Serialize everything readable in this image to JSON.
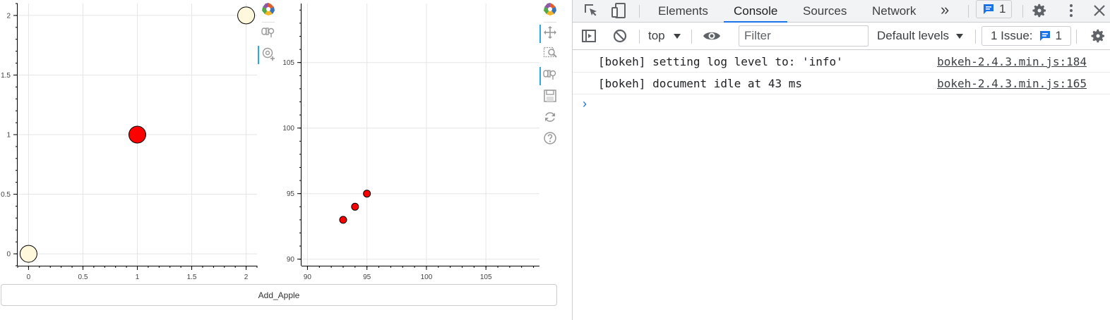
{
  "bokeh": {
    "button_label": "Add_Apple",
    "toolbar_left": [
      "bokeh-logo-icon",
      "wheel-zoom-icon",
      "hover-icon"
    ],
    "toolbar_right": [
      "bokeh-logo-icon",
      "pan-icon",
      "box-zoom-icon",
      "wheel-zoom-icon",
      "save-icon",
      "reset-icon",
      "help-icon"
    ]
  },
  "chart_data": [
    {
      "type": "scatter",
      "xlim": [
        -0.1,
        2.1
      ],
      "ylim": [
        -0.1,
        2.1
      ],
      "xticks": [
        "0",
        "0.5",
        "1",
        "1.5",
        "2"
      ],
      "yticks": [
        "0",
        "0.5",
        "1",
        "1.5",
        "2"
      ],
      "grid": true,
      "points": [
        {
          "x": 0,
          "y": 0,
          "size": 24,
          "color": "#fff8dc"
        },
        {
          "x": 1,
          "y": 1,
          "size": 24,
          "color": "#ff0000"
        },
        {
          "x": 2,
          "y": 2,
          "size": 24,
          "color": "#fff8dc"
        }
      ]
    },
    {
      "type": "scatter",
      "xlim": [
        89.5,
        109.5
      ],
      "ylim": [
        89.5,
        109.5
      ],
      "xticks": [
        "90",
        "95",
        "100",
        "105"
      ],
      "yticks": [
        "90",
        "95",
        "100",
        "105"
      ],
      "grid": true,
      "points": [
        {
          "x": 93,
          "y": 93,
          "size": 10,
          "color": "#ff0000"
        },
        {
          "x": 94,
          "y": 94,
          "size": 10,
          "color": "#ff0000"
        },
        {
          "x": 95,
          "y": 95,
          "size": 10,
          "color": "#ff0000"
        }
      ]
    }
  ],
  "devtools": {
    "tabs": [
      "Elements",
      "Console",
      "Sources",
      "Network"
    ],
    "more_tabs": "»",
    "messages_badge": "1",
    "context": "top",
    "filter_placeholder": "Filter",
    "levels": "Default levels",
    "issues_label": "1 Issue:",
    "issues_count": "1",
    "console": [
      {
        "message": "[bokeh] setting log level to: 'info'",
        "source": "bokeh-2.4.3.min.js:184"
      },
      {
        "message": "[bokeh] document idle at 43 ms",
        "source": "bokeh-2.4.3.min.js:165"
      }
    ],
    "prompt_symbol": "›",
    "accent": "#1a73e8"
  }
}
